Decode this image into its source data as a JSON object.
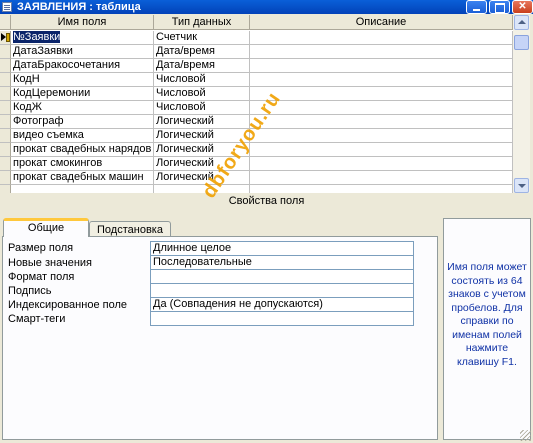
{
  "window": {
    "title": "ЗАЯВЛЕНИЯ : таблица"
  },
  "grid": {
    "headers": {
      "name": "Имя поля",
      "type": "Тип данных",
      "description": "Описание"
    },
    "rows": [
      {
        "name": "№Заявки",
        "type": "Счетчик",
        "description": ""
      },
      {
        "name": "ДатаЗаявки",
        "type": "Дата/время",
        "description": ""
      },
      {
        "name": "ДатаБракосочетания",
        "type": "Дата/время",
        "description": ""
      },
      {
        "name": "КодН",
        "type": "Числовой",
        "description": ""
      },
      {
        "name": "КодЦеремонии",
        "type": "Числовой",
        "description": ""
      },
      {
        "name": "КодЖ",
        "type": "Числовой",
        "description": ""
      },
      {
        "name": "Фотограф",
        "type": "Логический",
        "description": ""
      },
      {
        "name": "видео съемка",
        "type": "Логический",
        "description": ""
      },
      {
        "name": "прокат свадебных нарядов",
        "type": "Логический",
        "description": ""
      },
      {
        "name": "прокат смокингов",
        "type": "Логический",
        "description": ""
      },
      {
        "name": "прокат свадебных машин",
        "type": "Логический",
        "description": ""
      },
      {
        "name": "",
        "type": "",
        "description": ""
      }
    ]
  },
  "properties": {
    "section_label": "Свойства поля",
    "tabs": {
      "general": "Общие",
      "lookup": "Подстановка"
    },
    "items": [
      {
        "label": "Размер поля",
        "value": "Длинное целое"
      },
      {
        "label": "Новые значения",
        "value": "Последовательные"
      },
      {
        "label": "Формат поля",
        "value": ""
      },
      {
        "label": "Подпись",
        "value": ""
      },
      {
        "label": "Индексированное поле",
        "value": "Да (Совпадения не допускаются)"
      },
      {
        "label": "Смарт-теги",
        "value": ""
      }
    ],
    "help_text": "Имя поля может состоять из 64 знаков с учетом пробелов. Для справки по именам полей нажмите клавишу F1."
  },
  "watermark": "dbforyou.ru",
  "colors": {
    "title_bar": "#0242b8",
    "help_text": "#1032a6",
    "watermark": "#f0a000",
    "selection": "#0a246a"
  }
}
